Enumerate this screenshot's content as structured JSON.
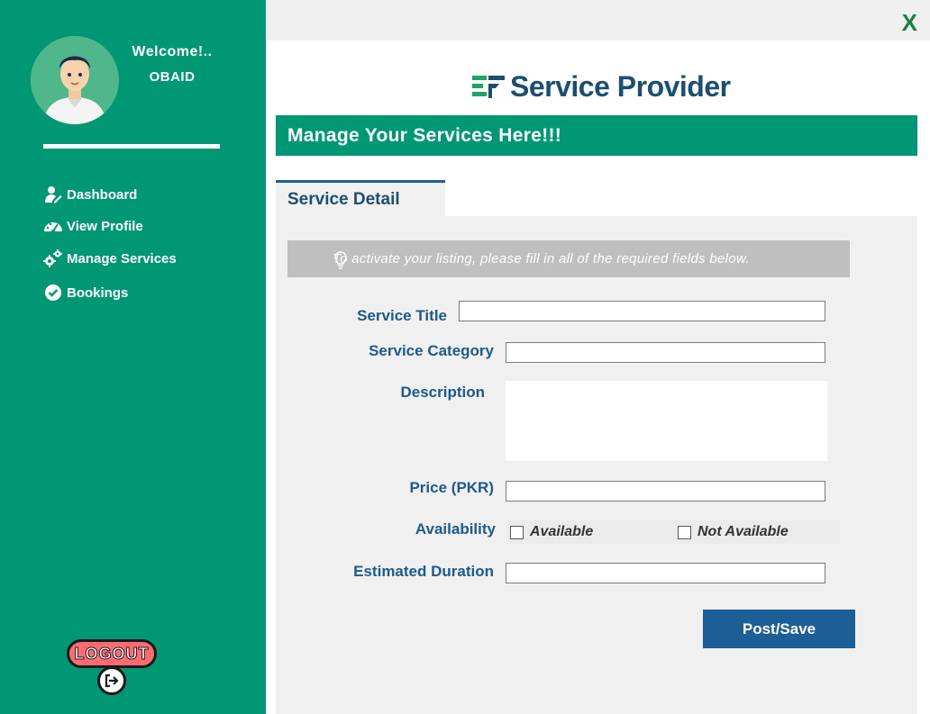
{
  "sidebar": {
    "welcome": "Welcome!..",
    "username": "OBAID",
    "items": [
      {
        "label": "Dashboard",
        "icon": "user-edit-icon"
      },
      {
        "label": "View Profile",
        "icon": "gauge-icon"
      },
      {
        "label": "Manage Services",
        "icon": "gears-icon"
      },
      {
        "label": "Bookings",
        "icon": "check-circle-icon"
      }
    ],
    "logout_label": "LOGOUT"
  },
  "window": {
    "close_label": "X"
  },
  "brand": {
    "name": "Service Provider"
  },
  "page": {
    "heading": "Manage Your Services Here!!!"
  },
  "tab": {
    "label": "Service Detail"
  },
  "notice": {
    "text": "To activate your listing, please fill in all of the required fields below."
  },
  "form": {
    "title_label": "Service Title",
    "title_value": "",
    "category_label": "Service Category",
    "category_value": "",
    "description_label": "Description",
    "description_value": "",
    "price_label": "Price (PKR)",
    "price_value": "",
    "availability_label": "Availability",
    "available_option": "Available",
    "not_available_option": "Not Available",
    "duration_label": "Estimated Duration",
    "duration_value": "",
    "submit_label": "Post/Save"
  },
  "colors": {
    "sidebar": "#009874",
    "heading": "#009874",
    "label": "#1b5a8a",
    "button": "#1b5f96",
    "close": "#1e7e45"
  }
}
